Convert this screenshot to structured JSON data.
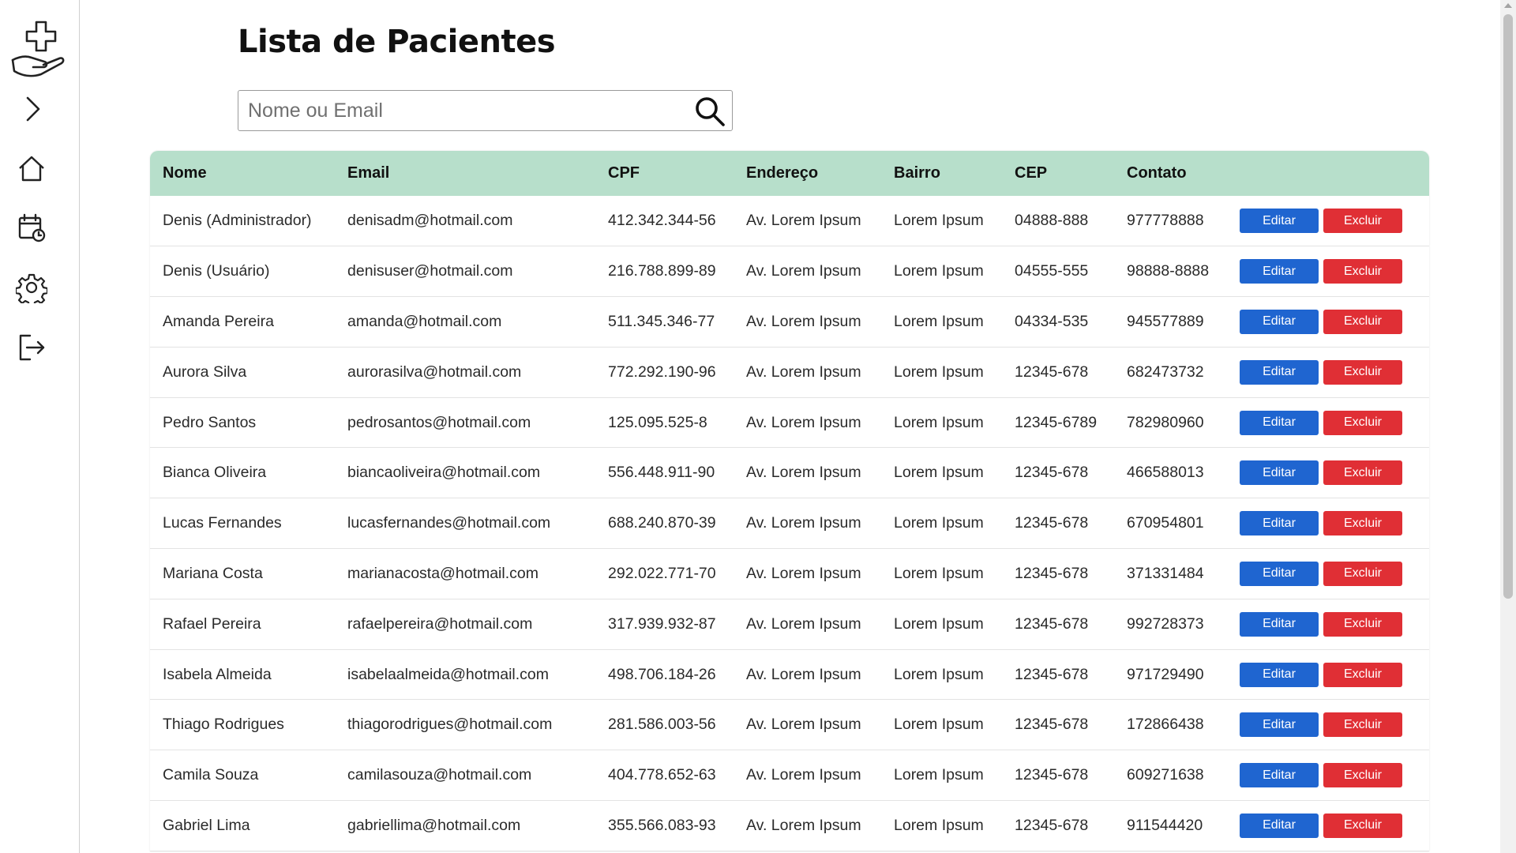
{
  "page": {
    "title": "Lista de Pacientes"
  },
  "sidebar": {
    "items": [
      {
        "name": "expand",
        "icon": "chevron-right-icon"
      },
      {
        "name": "home",
        "icon": "home-icon"
      },
      {
        "name": "calendar",
        "icon": "calendar-clock-icon"
      },
      {
        "name": "settings",
        "icon": "gear-icon"
      },
      {
        "name": "logout",
        "icon": "logout-icon"
      }
    ]
  },
  "search": {
    "placeholder": "Nome ou Email",
    "value": ""
  },
  "table": {
    "headers": [
      "Nome",
      "Email",
      "CPF",
      "Endereço",
      "Bairro",
      "CEP",
      "Contato"
    ],
    "edit_label": "Editar",
    "delete_label": "Excluir",
    "rows": [
      [
        "Denis (Administrador)",
        "denisadm@hotmail.com",
        "412.342.344-56",
        "Av. Lorem Ipsum",
        "Lorem Ipsum",
        "04888-888",
        "977778888"
      ],
      [
        "Denis (Usuário)",
        "denisuser@hotmail.com",
        "216.788.899-89",
        "Av. Lorem Ipsum",
        "Lorem Ipsum",
        "04555-555",
        "98888-8888"
      ],
      [
        "Amanda Pereira",
        "amanda@hotmail.com",
        "511.345.346-77",
        "Av. Lorem Ipsum",
        "Lorem Ipsum",
        "04334-535",
        "945577889"
      ],
      [
        "Aurora Silva",
        "aurorasilva@hotmail.com",
        "772.292.190-96",
        "Av. Lorem Ipsum",
        "Lorem Ipsum",
        "12345-678",
        "682473732"
      ],
      [
        "Pedro Santos",
        "pedrosantos@hotmail.com",
        "125.095.525-8",
        "Av. Lorem Ipsum",
        "Lorem Ipsum",
        "12345-6789",
        "782980960"
      ],
      [
        "Bianca Oliveira",
        "biancaoliveira@hotmail.com",
        "556.448.911-90",
        "Av. Lorem Ipsum",
        "Lorem Ipsum",
        "12345-678",
        "466588013"
      ],
      [
        "Lucas Fernandes",
        "lucasfernandes@hotmail.com",
        "688.240.870-39",
        "Av. Lorem Ipsum",
        "Lorem Ipsum",
        "12345-678",
        "670954801"
      ],
      [
        "Mariana Costa",
        "marianacosta@hotmail.com",
        "292.022.771-70",
        "Av. Lorem Ipsum",
        "Lorem Ipsum",
        "12345-678",
        "371331484"
      ],
      [
        "Rafael Pereira",
        "rafaelpereira@hotmail.com",
        "317.939.932-87",
        "Av. Lorem Ipsum",
        "Lorem Ipsum",
        "12345-678",
        "992728373"
      ],
      [
        "Isabela Almeida",
        "isabelaalmeida@hotmail.com",
        "498.706.184-26",
        "Av. Lorem Ipsum",
        "Lorem Ipsum",
        "12345-678",
        "971729490"
      ],
      [
        "Thiago Rodrigues",
        "thiagorodrigues@hotmail.com",
        "281.586.003-56",
        "Av. Lorem Ipsum",
        "Lorem Ipsum",
        "12345-678",
        "172866438"
      ],
      [
        "Camila Souza",
        "camilasouza@hotmail.com",
        "404.778.652-63",
        "Av. Lorem Ipsum",
        "Lorem Ipsum",
        "12345-678",
        "609271638"
      ],
      [
        "Gabriel Lima",
        "gabriellima@hotmail.com",
        "355.566.083-93",
        "Av. Lorem Ipsum",
        "Lorem Ipsum",
        "12345-678",
        "911544420"
      ]
    ]
  },
  "colors": {
    "header_bg": "#b7dfcb",
    "edit_button": "#1f65d0",
    "delete_button": "#e02f35"
  }
}
